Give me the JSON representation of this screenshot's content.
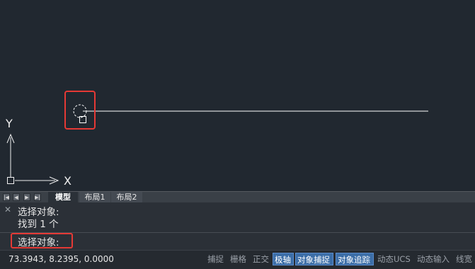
{
  "canvas": {
    "axis_x_label": "X",
    "axis_y_label": "Y",
    "crosshair_color": "#ffffff",
    "line_color": "#ffffff",
    "highlight_color": "#e53935"
  },
  "tabs": {
    "nav_icons": [
      "first-tab-icon",
      "prev-tab-icon",
      "next-tab-icon",
      "last-tab-icon"
    ],
    "nav_glyphs": [
      "|◀",
      "◀",
      "▶",
      "▶|"
    ],
    "model": "模型",
    "layout1": "布局1",
    "layout2": "布局2"
  },
  "command": {
    "history_line1": "选择对象:",
    "history_line2": "找到 1 个",
    "prompt": "选择对象:"
  },
  "status": {
    "coordinates": "73.3943, 8.2395, 0.0000",
    "buttons": [
      {
        "label": "捕捉",
        "active": false
      },
      {
        "label": "栅格",
        "active": false
      },
      {
        "label": "正交",
        "active": false
      },
      {
        "label": "极轴",
        "active": true
      },
      {
        "label": "对象捕捉",
        "active": true
      },
      {
        "label": "对象追踪",
        "active": true
      },
      {
        "label": "动态UCS",
        "active": false
      },
      {
        "label": "动态输入",
        "active": false
      },
      {
        "label": "线宽",
        "active": false
      }
    ]
  }
}
